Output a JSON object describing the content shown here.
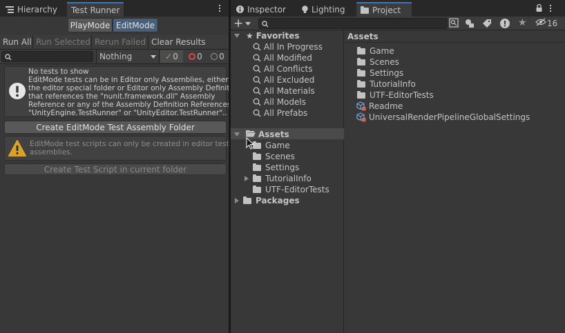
{
  "left_panel": {
    "tabs": [
      {
        "label": "Hierarchy",
        "icon": "hierarchy-icon"
      },
      {
        "label": "Test Runner",
        "icon": ""
      }
    ],
    "mode_buttons": [
      {
        "label": "PlayMode",
        "active": false
      },
      {
        "label": "EditMode",
        "active": true
      }
    ],
    "toolbar": {
      "run_all": "Run All",
      "run_selected": "Run Selected",
      "rerun_failed": "Rerun Failed",
      "clear_results": "Clear Results"
    },
    "filter": {
      "search_placeholder": "",
      "category_value": "Nothing",
      "passed_count": "0",
      "failed_count": "0",
      "skipped_count": "0"
    },
    "info_box": {
      "line1": "No tests to show",
      "line2": "EditMode tests can be in Editor only Assemblies, either in",
      "line3": "the editor special folder or Editor only Assembly Definitions",
      "line4": "that references the \"nunit.framework.dll\" Assembly",
      "line5": "Reference or any of the Assembly Definition References",
      "line6": "\"UnityEngine.TestRunner\" or \"UnityEditor.TestRunner\".."
    },
    "create_assembly_button": "Create EditMode Test Assembly Folder",
    "warning_box": {
      "line1": "EditMode test scripts can only be created in editor test",
      "line2": "assemblies."
    },
    "create_script_button": "Create Test Script in current folder"
  },
  "right_panel": {
    "tabs": [
      {
        "label": "Inspector",
        "icon": "info-icon"
      },
      {
        "label": "Lighting",
        "icon": "bulb-icon"
      },
      {
        "label": "Project",
        "icon": "folder-icon"
      }
    ],
    "search_placeholder": "",
    "hidden_count": "16",
    "tree": {
      "favorites_label": "Favorites",
      "favorites": [
        "All In Progress",
        "All Modified",
        "All Conflicts",
        "All Excluded",
        "All Materials",
        "All Models",
        "All Prefabs"
      ],
      "assets_label": "Assets",
      "assets_children": [
        {
          "label": "Game",
          "expandable": false
        },
        {
          "label": "Scenes",
          "expandable": false
        },
        {
          "label": "Settings",
          "expandable": false
        },
        {
          "label": "TutorialInfo",
          "expandable": true
        },
        {
          "label": "UTF-EditorTests",
          "expandable": false
        }
      ],
      "packages_label": "Packages"
    },
    "content": {
      "header": "Assets",
      "items": [
        {
          "label": "Game",
          "type": "folder"
        },
        {
          "label": "Scenes",
          "type": "folder"
        },
        {
          "label": "Settings",
          "type": "folder"
        },
        {
          "label": "TutorialInfo",
          "type": "folder"
        },
        {
          "label": "UTF-EditorTests",
          "type": "folder"
        },
        {
          "label": "Readme",
          "type": "asset"
        },
        {
          "label": "UniversalRenderPipelineGlobalSettings",
          "type": "asset"
        }
      ]
    }
  },
  "colors": {
    "accent": "#3a79bb",
    "passed": "#5cc95c",
    "failed": "#e04848",
    "warning": "#d9a22b"
  }
}
